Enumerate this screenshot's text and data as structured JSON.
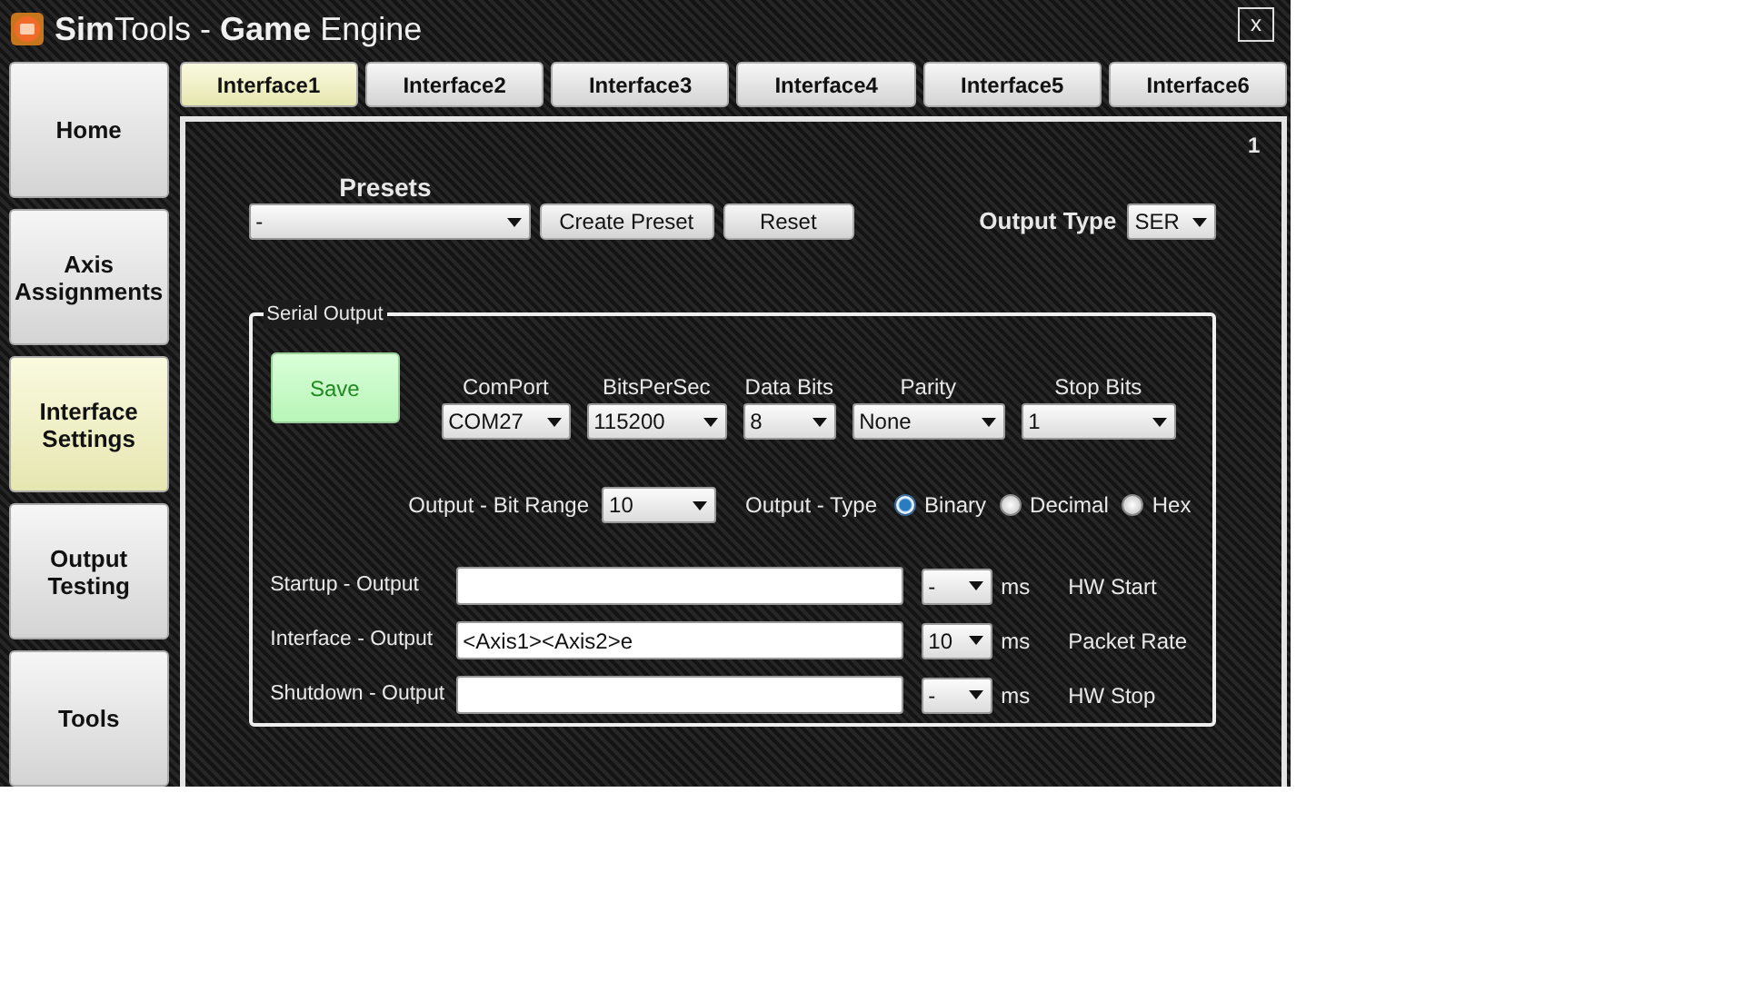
{
  "window": {
    "title": "**Sim**Tools - **Game** Engine",
    "close": "x"
  },
  "sidebar": {
    "items": [
      {
        "label": "Home",
        "selected": false
      },
      {
        "label": "Axis Assignments",
        "selected": false
      },
      {
        "label": "Interface Settings",
        "selected": true
      },
      {
        "label": "Output Testing",
        "selected": false
      },
      {
        "label": "Tools",
        "selected": false
      }
    ]
  },
  "tabs": [
    {
      "label": "Interface1",
      "selected": true
    },
    {
      "label": "Interface2",
      "selected": false
    },
    {
      "label": "Interface3",
      "selected": false
    },
    {
      "label": "Interface4",
      "selected": false
    },
    {
      "label": "Interface5",
      "selected": false
    },
    {
      "label": "Interface6",
      "selected": false
    }
  ],
  "panel": {
    "number": "1",
    "presets": {
      "label": "Presets",
      "value": "-"
    },
    "buttons": [
      "Create Preset",
      "Reset"
    ],
    "output_type": {
      "label": "Output Type",
      "value": "SER"
    }
  },
  "serial_output": {
    "title": "Serial Output",
    "save_button": "Save",
    "settings": [
      {
        "label": "ComPort",
        "value": "COM27"
      },
      {
        "label": "BitsPerSec",
        "value": "115200"
      },
      {
        "label": "Data Bits",
        "value": "8"
      },
      {
        "label": "Parity",
        "value": "None"
      },
      {
        "label": "Stop Bits",
        "value": "1"
      }
    ],
    "bit_range": {
      "label": "Output - Bit Range",
      "value": "10"
    },
    "output_type": {
      "label": "Output - Type",
      "options": [
        {
          "label": "Binary",
          "selected": true
        },
        {
          "label": "Decimal",
          "selected": false
        },
        {
          "label": "Hex",
          "selected": false
        }
      ]
    },
    "outputs": [
      {
        "label": "Startup - Output",
        "delay": "-",
        "unit": "ms",
        "note": "HW Start"
      },
      {
        "label": "Interface - Output",
        "value": "<Axis1><Axis2>e",
        "delay": "10",
        "unit": "ms",
        "note": "Packet Rate"
      },
      {
        "label": "Shutdown - Output",
        "delay": "-",
        "unit": "ms",
        "note": "HW Stop"
      }
    ]
  }
}
